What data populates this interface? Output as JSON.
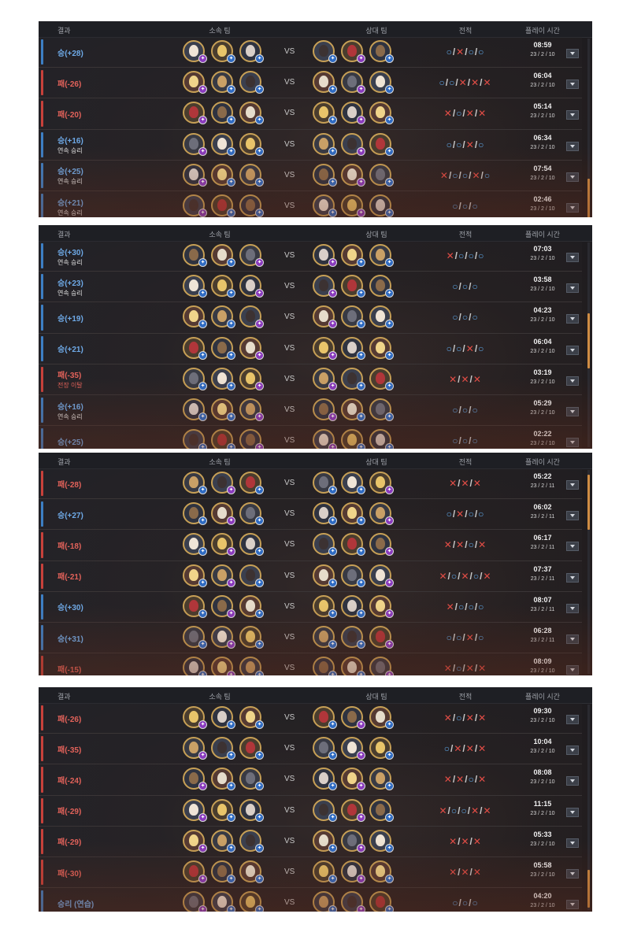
{
  "headers": {
    "result": "결과",
    "my_team": "소속 팀",
    "opp_team": "상대 팀",
    "record": "전적",
    "play_time": "플레이 시간"
  },
  "vs": "VS",
  "panels": [
    {
      "rows": [
        {
          "type": "win",
          "result": "승(+28)",
          "sub": "",
          "record": "O/X/O/O",
          "time": "08:59",
          "date": "23 / 2 / 10"
        },
        {
          "type": "loss",
          "result": "패(-26)",
          "sub": "",
          "record": "O/O/X/X/X",
          "time": "06:04",
          "date": "23 / 2 / 10"
        },
        {
          "type": "loss",
          "result": "패(-20)",
          "sub": "",
          "record": "X/O/X/X",
          "time": "05:14",
          "date": "23 / 2 / 10"
        },
        {
          "type": "win",
          "result": "승(+16)",
          "sub": "연속 승리",
          "record": "O/O/X/O",
          "time": "06:34",
          "date": "23 / 2 / 10"
        },
        {
          "type": "win",
          "result": "승(+25)",
          "sub": "연속 승리",
          "record": "X/O/O/X/O",
          "time": "07:54",
          "date": "23 / 2 / 10"
        },
        {
          "type": "win",
          "result": "승(+21)",
          "sub": "연속 승리",
          "record": "O/O/O",
          "time": "02:46",
          "date": "23 / 2 / 10"
        }
      ]
    },
    {
      "rows": [
        {
          "type": "win",
          "result": "승(+30)",
          "sub": "연속 승리",
          "record": "X/O/O/O",
          "time": "07:03",
          "date": "23 / 2 / 10"
        },
        {
          "type": "win",
          "result": "승(+23)",
          "sub": "연속 승리",
          "record": "O/O/O",
          "time": "03:58",
          "date": "23 / 2 / 10"
        },
        {
          "type": "win",
          "result": "승(+19)",
          "sub": "",
          "record": "O/O/O",
          "time": "04:23",
          "date": "23 / 2 / 10"
        },
        {
          "type": "win",
          "result": "승(+21)",
          "sub": "",
          "record": "O/O/X/O",
          "time": "06:04",
          "date": "23 / 2 / 10"
        },
        {
          "type": "loss",
          "result": "패(-35)",
          "sub": "전장 이탈",
          "record": "X/X/X",
          "time": "03:19",
          "date": "23 / 2 / 10"
        },
        {
          "type": "win",
          "result": "승(+16)",
          "sub": "연속 승리",
          "record": "O/O/O",
          "time": "05:29",
          "date": "23 / 2 / 10"
        },
        {
          "type": "win",
          "result": "승(+25)",
          "sub": "",
          "record": "O/O/O",
          "time": "02:22",
          "date": "23 / 2 / 10"
        }
      ]
    },
    {
      "rows": [
        {
          "type": "loss",
          "result": "패(-28)",
          "sub": "",
          "record": "X/X/X",
          "time": "05:22",
          "date": "23 / 2 / 11"
        },
        {
          "type": "win",
          "result": "승(+27)",
          "sub": "",
          "record": "O/X/O/O",
          "time": "06:02",
          "date": "23 / 2 / 11"
        },
        {
          "type": "loss",
          "result": "패(-18)",
          "sub": "",
          "record": "X/X/O/X",
          "time": "06:17",
          "date": "23 / 2 / 11"
        },
        {
          "type": "loss",
          "result": "패(-21)",
          "sub": "",
          "record": "X/O/X/O/X",
          "time": "07:37",
          "date": "23 / 2 / 11"
        },
        {
          "type": "win",
          "result": "승(+30)",
          "sub": "",
          "record": "X/O/O/O",
          "time": "08:07",
          "date": "23 / 2 / 11"
        },
        {
          "type": "win",
          "result": "승(+31)",
          "sub": "",
          "record": "O/O/X/O",
          "time": "06:28",
          "date": "23 / 2 / 11"
        },
        {
          "type": "loss",
          "result": "패(-15)",
          "sub": "",
          "record": "X/O/X/X",
          "time": "08:09",
          "date": "23 / 2 / 10"
        }
      ]
    },
    {
      "rows": [
        {
          "type": "loss",
          "result": "패(-26)",
          "sub": "",
          "record": "X/O/X/X",
          "time": "09:30",
          "date": "23 / 2 / 10"
        },
        {
          "type": "loss",
          "result": "패(-35)",
          "sub": "",
          "record": "O/X/X/X",
          "time": "10:04",
          "date": "23 / 2 / 10"
        },
        {
          "type": "loss",
          "result": "패(-24)",
          "sub": "",
          "record": "X/X/O/X",
          "time": "08:08",
          "date": "23 / 2 / 10"
        },
        {
          "type": "loss",
          "result": "패(-29)",
          "sub": "",
          "record": "X/O/O/X/X",
          "time": "11:15",
          "date": "23 / 2 / 10"
        },
        {
          "type": "loss",
          "result": "패(-29)",
          "sub": "",
          "record": "X/X/X",
          "time": "05:33",
          "date": "23 / 2 / 10"
        },
        {
          "type": "loss",
          "result": "패(-30)",
          "sub": "",
          "record": "X/X/X",
          "time": "05:58",
          "date": "23 / 2 / 10"
        },
        {
          "type": "win",
          "result": "승리 (연습)",
          "sub": "",
          "record": "O/O/O",
          "time": "04:20",
          "date": "23 / 2 / 10"
        }
      ]
    }
  ]
}
